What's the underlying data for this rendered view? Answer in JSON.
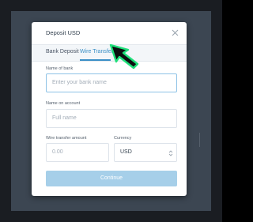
{
  "modal": {
    "title": "Deposit USD",
    "close_icon": "close-icon"
  },
  "tabs": [
    {
      "label": "Bank Deposit",
      "active": false
    },
    {
      "label": "Wire Transfer",
      "active": true
    }
  ],
  "form": {
    "bank_name": {
      "label": "Name of bank",
      "placeholder": "Enter your bank name",
      "value": ""
    },
    "account_name": {
      "label": "Name on account",
      "placeholder": "Full name",
      "value": ""
    },
    "amount": {
      "label": "Wire transfer amount",
      "placeholder": "0.00",
      "value": ""
    },
    "currency": {
      "label": "Currency",
      "value": "USD"
    }
  },
  "continue_label": "Continue",
  "colors": {
    "accent": "#3a8fc6",
    "button_disabled": "#a6cfe9",
    "cursor_glow": "#1fe07a",
    "backdrop": "#3c4652"
  },
  "pointer_icon": "mouse-pointer-icon"
}
